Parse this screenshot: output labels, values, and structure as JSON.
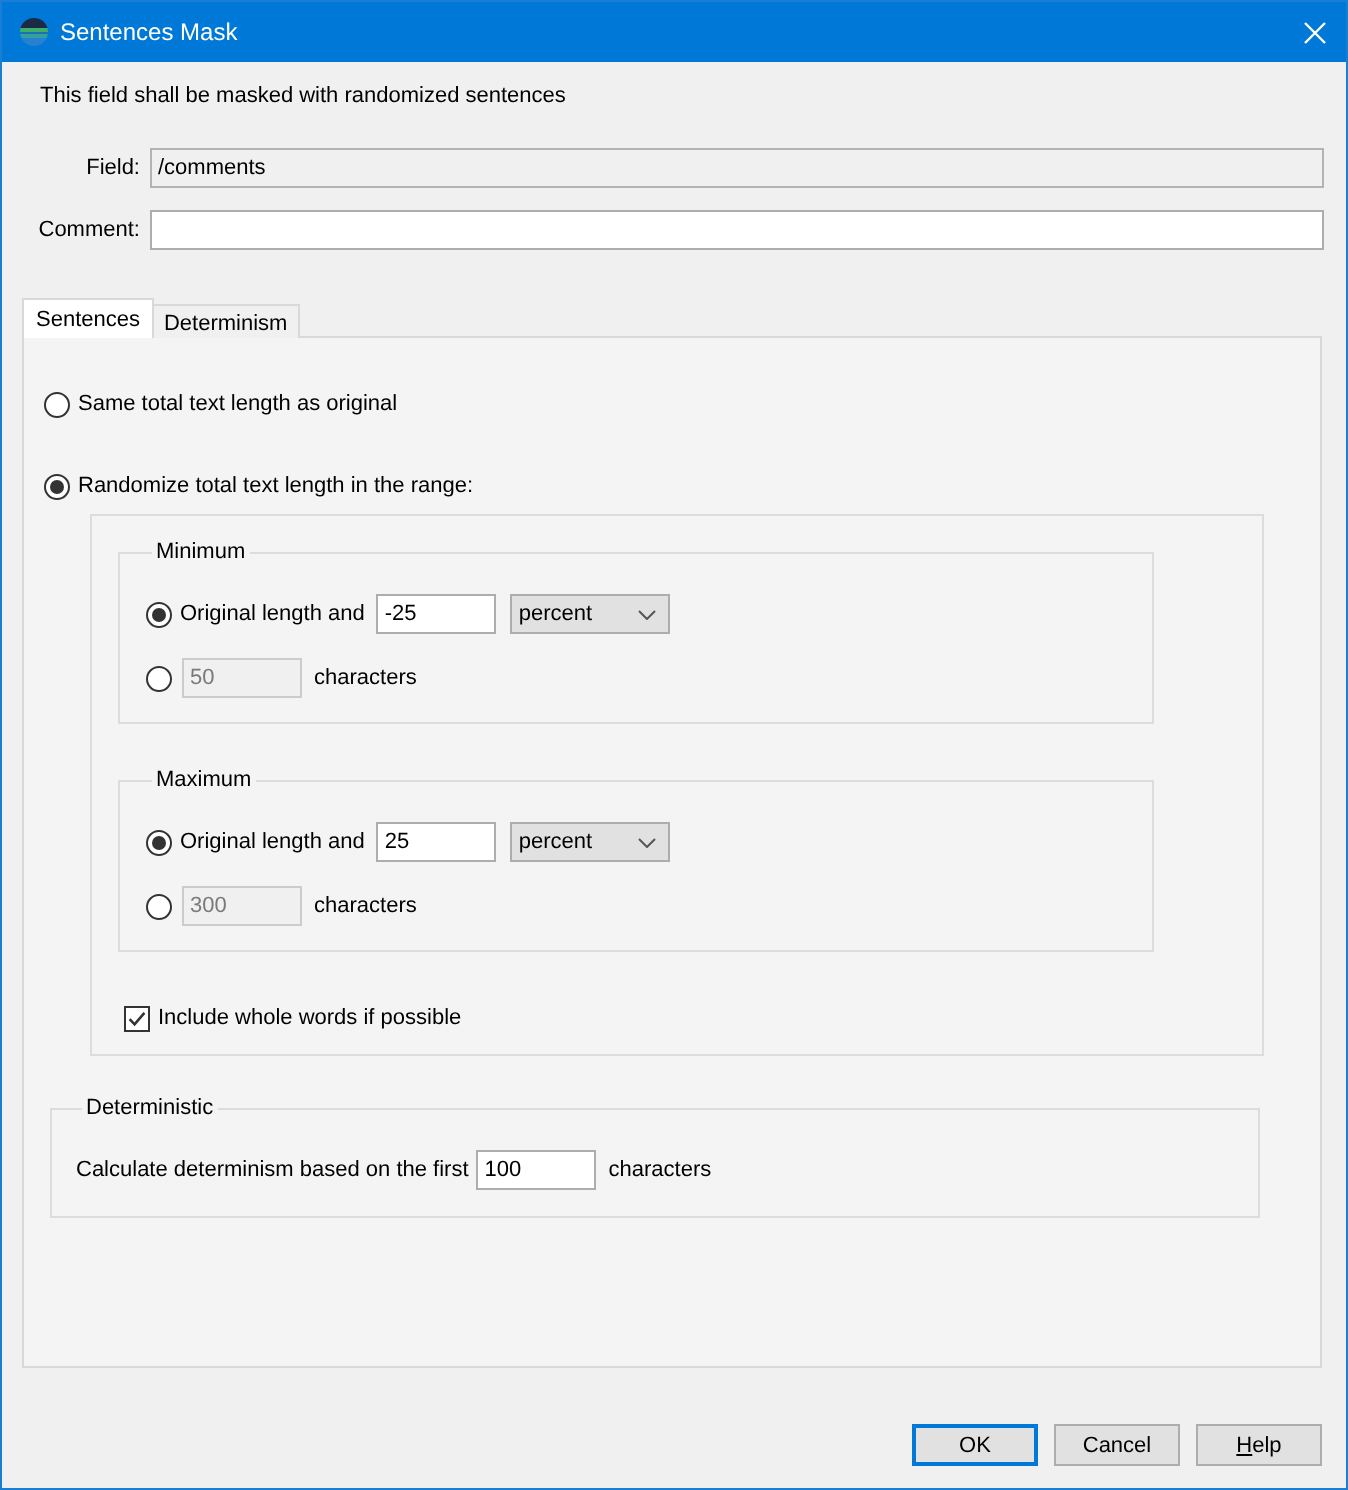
{
  "window": {
    "title": "Sentences Mask"
  },
  "description": "This field shall be masked with randomized sentences",
  "fields": [
    {
      "label": "Field:",
      "value": "/comments",
      "read_only": true
    },
    {
      "label": "Comment:",
      "read_only": false
    }
  ],
  "tabs": [
    {
      "label": "Sentences",
      "selected": true
    },
    {
      "label": "Determinism",
      "selected": false
    }
  ],
  "length_options": [
    {
      "label": "Same total text length as original",
      "selected": false
    },
    {
      "label": "Randomize total text length in the range:",
      "selected": true
    }
  ],
  "range": {
    "groups": [
      {
        "title": "Minimum",
        "options": [
          {
            "kind": "relative",
            "selected": true,
            "disabled": false,
            "label": "Original length and",
            "value": "-25",
            "unit": "percent"
          },
          {
            "kind": "absolute",
            "selected": false,
            "disabled": true,
            "value": "50",
            "suffix": "characters"
          }
        ]
      },
      {
        "title": "Maximum",
        "options": [
          {
            "kind": "relative",
            "selected": true,
            "disabled": false,
            "label": "Original length and",
            "value": "25",
            "unit": "percent"
          },
          {
            "kind": "absolute",
            "selected": false,
            "disabled": true,
            "value": "300",
            "suffix": "characters"
          }
        ]
      }
    ],
    "whole_words": {
      "label": "Include whole words if possible",
      "checked": true
    }
  },
  "deterministic": {
    "title": "Deterministic",
    "label": "Calculate determinism based on the first",
    "value": "100",
    "suffix": "characters"
  },
  "buttons": [
    {
      "label": "OK",
      "default": true,
      "mnemonic_underlined": false
    },
    {
      "label": "Cancel",
      "default": false,
      "mnemonic_underlined": false
    },
    {
      "label": "Help",
      "default": false,
      "mnemonic_underlined": true
    }
  ]
}
